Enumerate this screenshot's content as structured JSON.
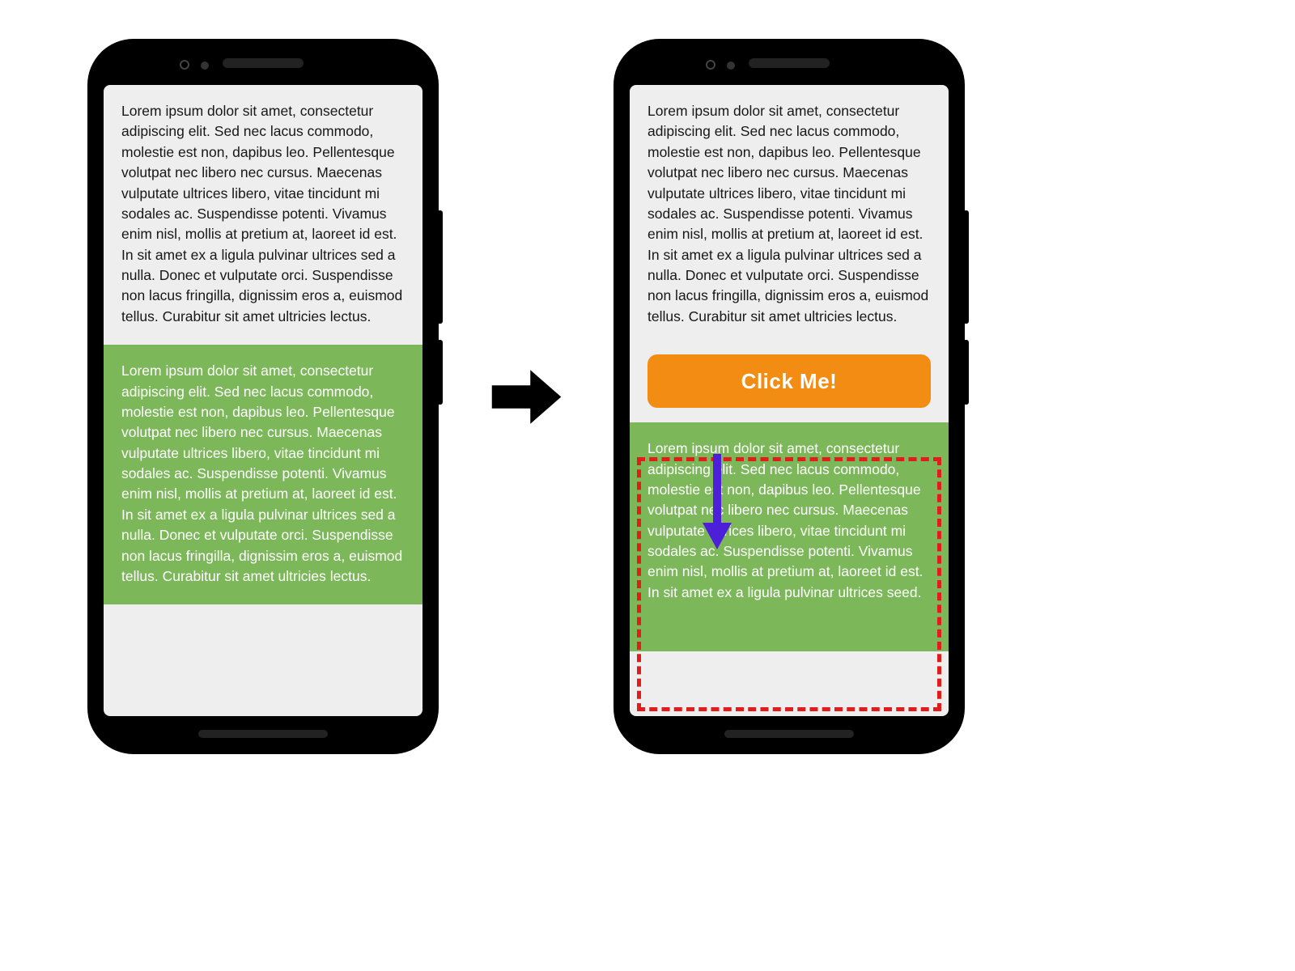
{
  "left_phone": {
    "paragraph_top": "Lorem ipsum dolor sit amet, consectetur adipiscing elit. Sed nec lacus commodo, molestie est non, dapibus leo. Pellentesque volutpat nec libero nec cursus. Maecenas vulputate ultrices libero, vitae tincidunt mi sodales ac. Suspendisse potenti. Vivamus enim nisl, mollis at pretium at, laoreet id est. In sit amet ex a ligula pulvinar ultrices sed a nulla. Donec et vulputate orci. Suspendisse non lacus fringilla, dignissim eros a, euismod tellus. Curabitur sit amet ultricies lectus.",
    "paragraph_green": "Lorem ipsum dolor sit amet, consectetur adipiscing elit. Sed nec lacus commodo, molestie est non, dapibus leo. Pellentesque volutpat nec libero nec cursus. Maecenas vulputate ultrices libero, vitae tincidunt mi sodales ac. Suspendisse potenti. Vivamus enim nisl, mollis at pretium at, laoreet id est. In sit amet ex a ligula pulvinar ultrices sed a nulla. Donec et vulputate orci. Suspendisse non lacus fringilla, dignissim eros a, euismod tellus. Curabitur sit amet ultricies lectus."
  },
  "right_phone": {
    "paragraph_top": "Lorem ipsum dolor sit amet, consectetur adipiscing elit. Sed nec lacus commodo, molestie est non, dapibus leo. Pellentesque volutpat nec libero nec cursus. Maecenas vulputate ultrices libero, vitae tincidunt mi sodales ac. Suspendisse potenti. Vivamus enim nisl, mollis at pretium at, laoreet id est. In sit amet ex a ligula pulvinar ultrices sed a nulla. Donec et vulputate orci. Suspendisse non lacus fringilla, dignissim eros a, euismod tellus. Curabitur sit amet ultricies lectus.",
    "button_label": "Click Me!",
    "paragraph_green": "Lorem ipsum dolor sit amet, consectetur adipiscing elit. Sed nec lacus commodo, molestie est non, dapibus leo. Pellentesque volutpat nec libero nec cursus. Maecenas vulputate ultrices libero, vitae tincidunt mi sodales ac. Suspendisse potenti. Vivamus enim nisl, mollis at pretium at, laoreet id est. In sit amet ex a ligula pulvinar ultrices seed."
  },
  "colors": {
    "green": "#7cb75a",
    "orange": "#f28c13",
    "highlight": "#e21b1b",
    "arrow_purple": "#4e1fd8"
  }
}
